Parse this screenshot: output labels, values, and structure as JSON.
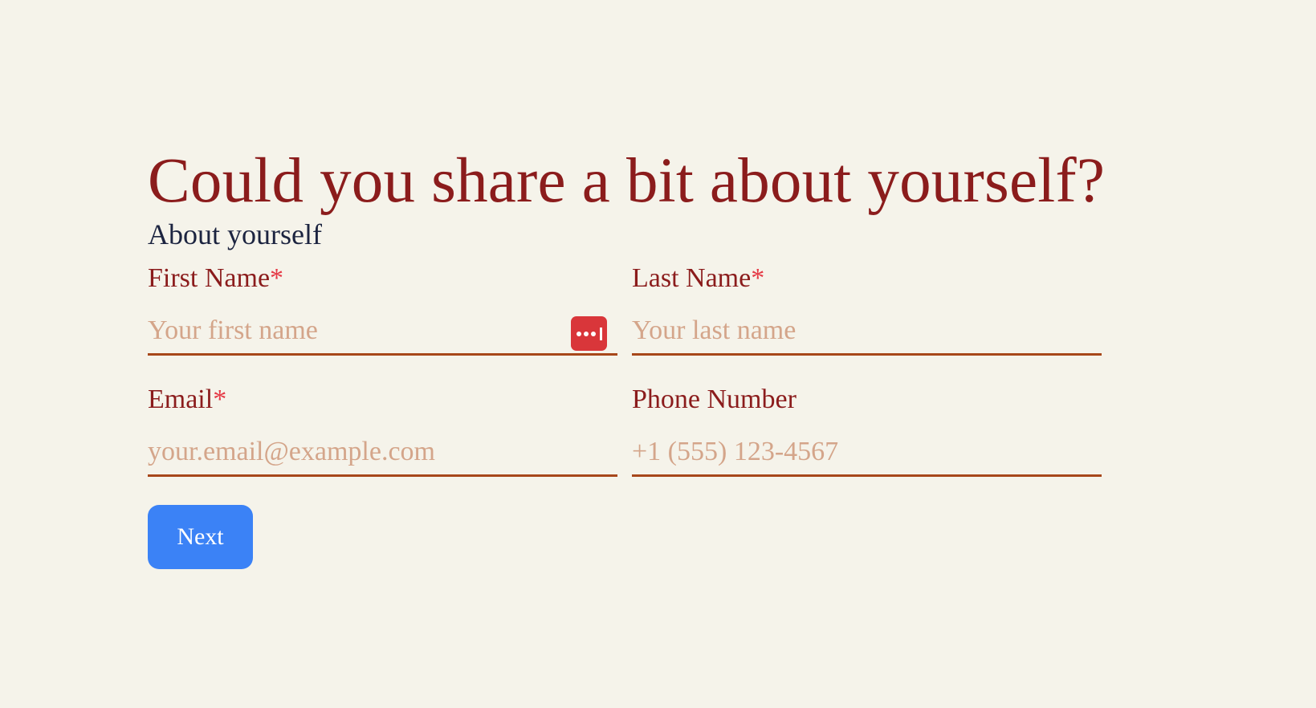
{
  "page": {
    "title": "Could you share a bit about yourself?",
    "subtitle": "About yourself"
  },
  "form": {
    "required_marker": "*",
    "first_name": {
      "label": "First Name",
      "required": true,
      "value": "",
      "placeholder": "Your first name"
    },
    "last_name": {
      "label": "Last Name",
      "required": true,
      "value": "",
      "placeholder": "Your last name"
    },
    "email": {
      "label": "Email",
      "required": true,
      "value": "",
      "placeholder": "your.email@example.com"
    },
    "phone": {
      "label": "Phone Number",
      "required": false,
      "value": "",
      "placeholder": "+1 (555) 123-4567"
    },
    "next_label": "Next",
    "password_manager_icon": "password-manager-icon"
  },
  "colors": {
    "background": "#f5f3ea",
    "title": "#8b1c1c",
    "subtitle": "#1c2440",
    "required": "#e53945",
    "underline": "#a7471a",
    "placeholder": "#d4a58a",
    "button": "#3b82f6",
    "password_manager": "#d9363a"
  }
}
